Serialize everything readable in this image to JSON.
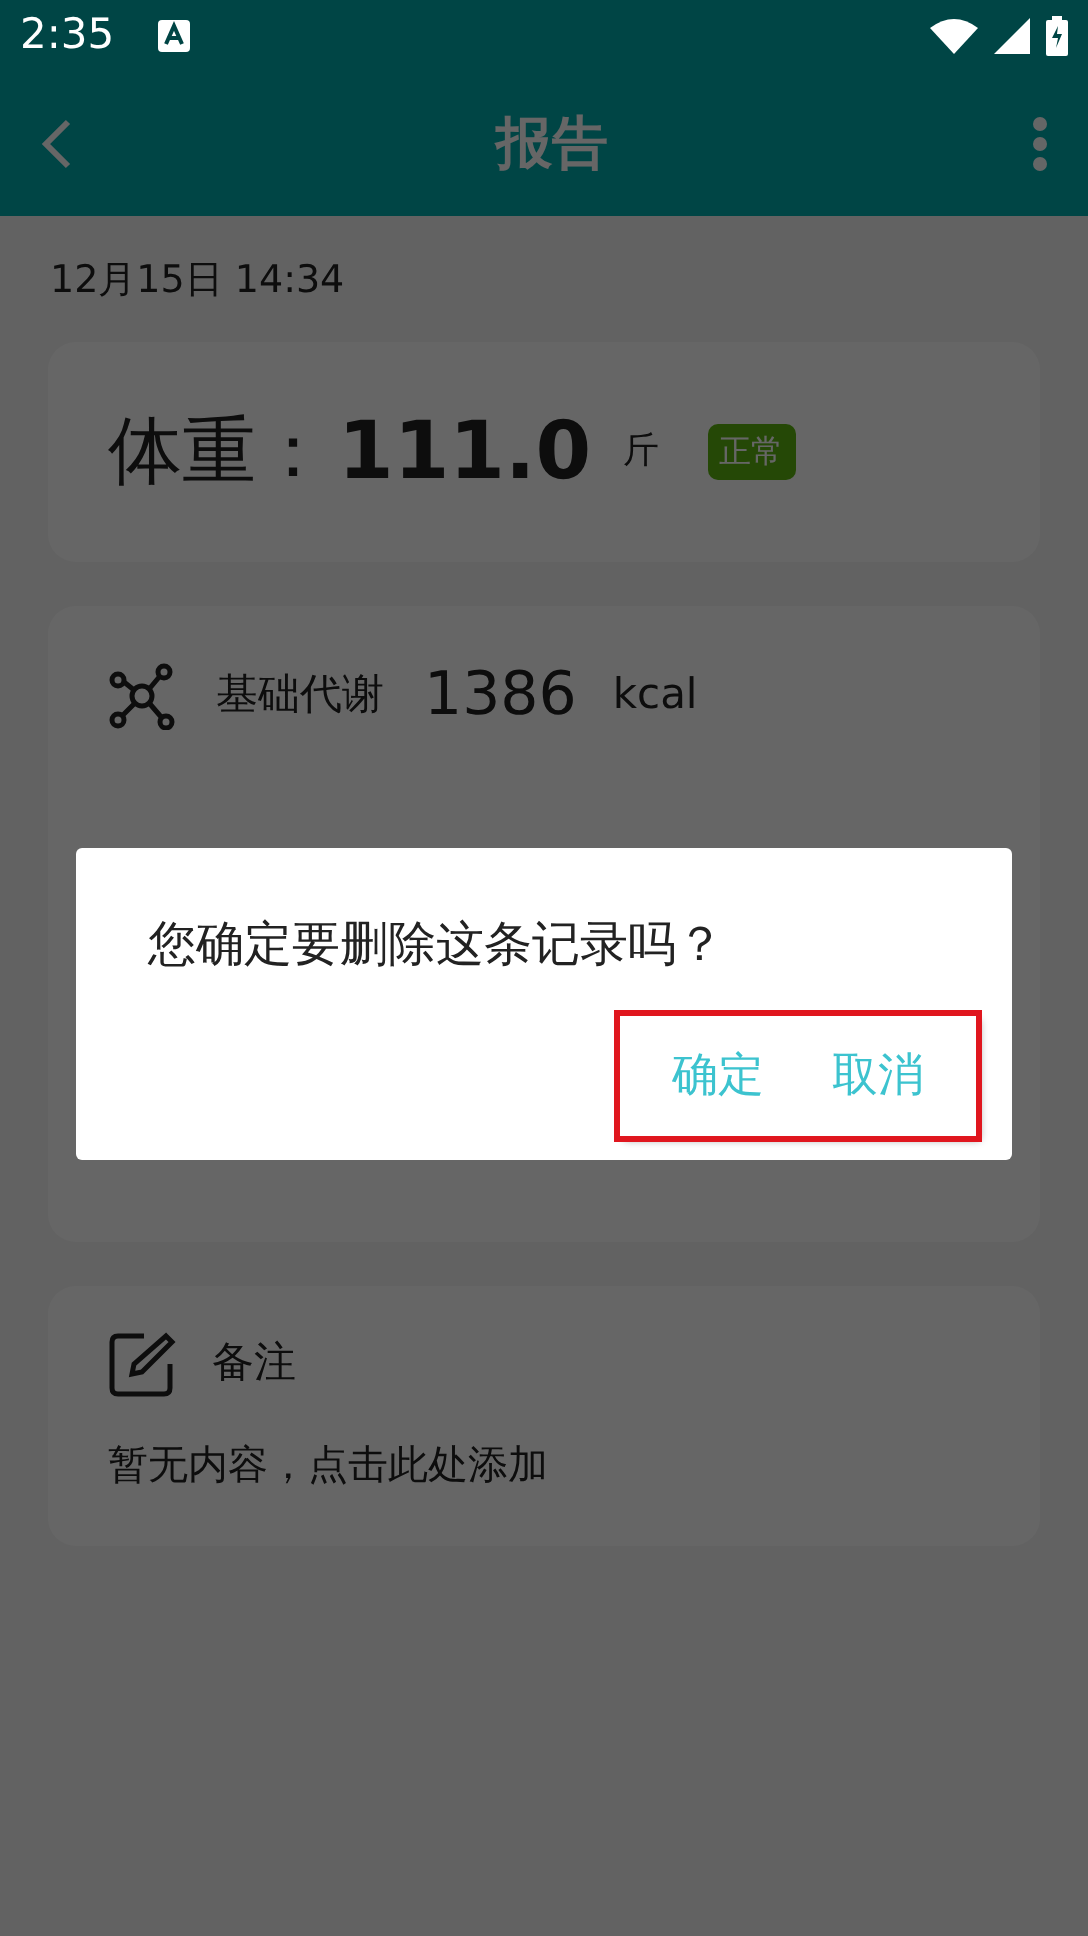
{
  "status_bar": {
    "time": "2:35"
  },
  "app_bar": {
    "title": "报告"
  },
  "date": "12月15日 14:34",
  "summary": {
    "label": "体重：",
    "value": "111.0",
    "unit": "斤",
    "status": "正常"
  },
  "metrics": [
    {
      "kind": "bmr",
      "label": "基础代谢",
      "value": "1386",
      "unit": "kcal"
    }
  ],
  "note": {
    "title": "备注",
    "hint": "暂无内容，点击此处添加"
  },
  "dialog": {
    "message": "您确定要删除这条记录吗？",
    "buttons": [
      "确定",
      "取消"
    ],
    "highlighted": true
  }
}
